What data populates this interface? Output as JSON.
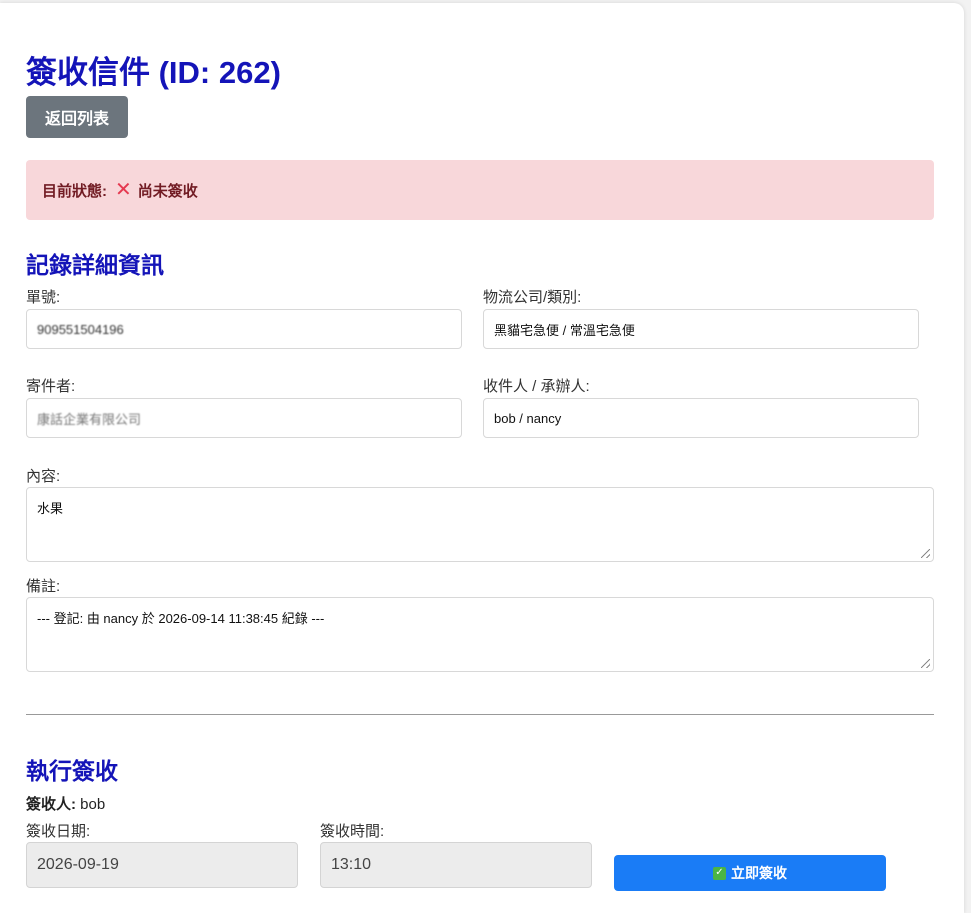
{
  "page": {
    "title": "簽收信件 (ID: 262)"
  },
  "actions": {
    "back_label": "返回列表"
  },
  "status": {
    "label": "目前狀態:",
    "value": "尚未簽收",
    "icon": "cross-mark-icon",
    "color": "#e53950"
  },
  "details": {
    "heading": "記錄詳細資訊",
    "tracking_label": "單號:",
    "tracking_value": "909551504196",
    "carrier_label": "物流公司/類別:",
    "carrier_value": "黑貓宅急便 / 常溫宅急便",
    "sender_label": "寄件者:",
    "sender_value": "康話企業有限公司",
    "recipient_label": "收件人 / 承辦人:",
    "recipient_value": "bob / nancy",
    "content_label": "內容:",
    "content_value": "水果",
    "notes_label": "備註:",
    "notes_value": "--- 登記: 由 nancy 於 2026-09-14 11:38:45 紀錄 ---"
  },
  "sign": {
    "heading": "執行簽收",
    "signer_label": "簽收人:",
    "signer_value": "bob",
    "date_label": "簽收日期:",
    "date_value": "2026-09-19",
    "time_label": "簽收時間:",
    "time_value": "13:10",
    "button_label": "立即簽收",
    "button_icon": "check-box-icon"
  },
  "colors": {
    "accent": "#1414b8",
    "primary_button": "#1a7cf6",
    "alert_bg": "#f8d7da",
    "alert_text": "#721c24"
  }
}
